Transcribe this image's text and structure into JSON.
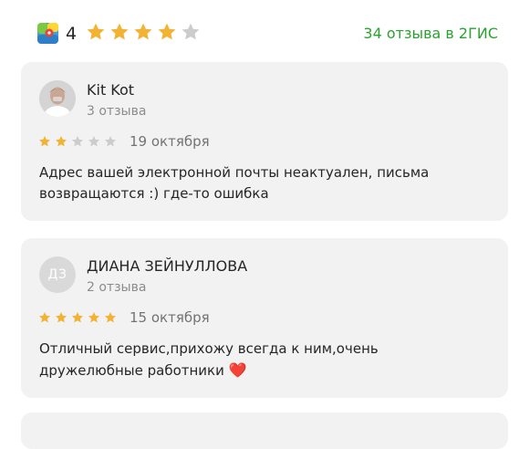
{
  "header": {
    "logo_icon": "2gis-map-icon",
    "rating": "4",
    "rating_stars": 4,
    "reviews_link": "34 отзыва в 2ГИС"
  },
  "colors": {
    "star_filled": "#f2b233",
    "star_empty": "#cccccc",
    "link_green": "#2aa22f",
    "card_background": "#f2f2f2"
  },
  "reviews": [
    {
      "author": "Kit Kot",
      "review_count": "3 отзыва",
      "avatar_type": "photo",
      "rating": 2,
      "date": "19 октября",
      "text": "Адрес вашей электронной почты неактуален, письма\nвозвращаются :) где-то ошибка"
    },
    {
      "author": "ДИАНА ЗЕЙНУЛЛОВА",
      "review_count": "2 отзыва",
      "avatar_type": "initials",
      "initials": "ДЗ",
      "rating": 5,
      "date": "15 октября",
      "text": "Отличный сервис,прихожу всегда к ним,очень\nдружелюбные работники",
      "emoji": "❤️"
    }
  ]
}
